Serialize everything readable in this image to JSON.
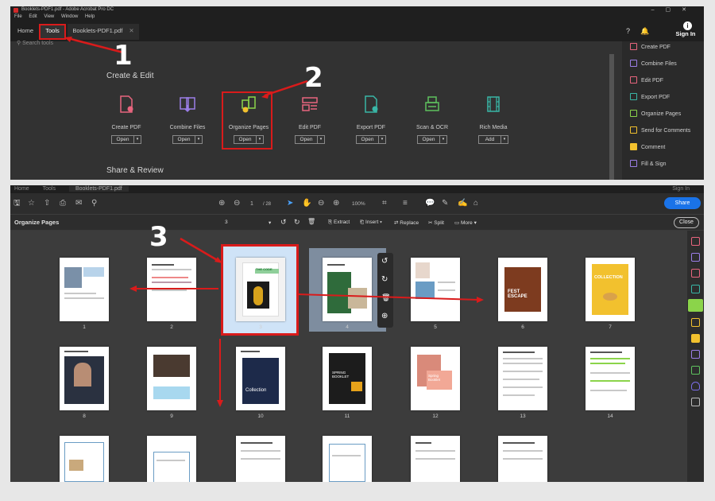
{
  "top": {
    "window_title": "Booklets-PDF1.pdf - Adobe Acrobat Pro DC",
    "menu": [
      "File",
      "Edit",
      "View",
      "Window",
      "Help"
    ],
    "tabs": {
      "home": "Home",
      "tools": "Tools",
      "doc": "Booklets-PDF1.pdf"
    },
    "signin": "Sign In",
    "search_placeholder": "Search tools",
    "section_create": "Create & Edit",
    "section_share": "Share & Review",
    "tools": [
      {
        "label": "Create PDF",
        "button": "Open",
        "color": "#e8657e"
      },
      {
        "label": "Combine Files",
        "button": "Open",
        "color": "#9b7ee8"
      },
      {
        "label": "Organize Pages",
        "button": "Open",
        "color": "#8bd44a"
      },
      {
        "label": "Edit PDF",
        "button": "Open",
        "color": "#e8657e"
      },
      {
        "label": "Export PDF",
        "button": "Open",
        "color": "#39b6a6"
      },
      {
        "label": "Scan & OCR",
        "button": "Open",
        "color": "#5ec15e"
      },
      {
        "label": "Rich Media",
        "button": "Add",
        "color": "#39b6a6"
      }
    ],
    "right_panel": [
      {
        "label": "Create PDF",
        "color": "#e8657e"
      },
      {
        "label": "Combine Files",
        "color": "#9b7ee8"
      },
      {
        "label": "Edit PDF",
        "color": "#e8657e"
      },
      {
        "label": "Export PDF",
        "color": "#39b6a6"
      },
      {
        "label": "Organize Pages",
        "color": "#8bd44a"
      },
      {
        "label": "Send for Comments",
        "color": "#f2c12e"
      },
      {
        "label": "Comment",
        "color": "#f2c12e"
      },
      {
        "label": "Fill & Sign",
        "color": "#9b7ee8"
      }
    ]
  },
  "steps": {
    "one": "1",
    "two": "2",
    "three": "3"
  },
  "bottom": {
    "tabs": {
      "home": "Home",
      "tools": "Tools",
      "doc": "Booklets-PDF1.pdf"
    },
    "signin": "Sign In",
    "page_current": "1",
    "page_total": "/ 28",
    "zoom": "100%",
    "share": "Share",
    "organize_title": "Organize Pages",
    "page_selector": "3",
    "tools": {
      "extract": "Extract",
      "insert": "Insert",
      "replace": "Replace",
      "split": "Split",
      "more": "More"
    },
    "close": "Close",
    "page_numbers": [
      "1",
      "2",
      "3",
      "4",
      "5",
      "6",
      "7",
      "8",
      "9",
      "10",
      "11",
      "12",
      "13",
      "14"
    ],
    "thumb_titles": {
      "p3": "THE CODE",
      "p6": "FEST ESCAPE",
      "p7": "COLLECTION",
      "p10": "Collection",
      "p11": "SPRING BOOKLET",
      "p12": "Spring Booklet"
    }
  }
}
